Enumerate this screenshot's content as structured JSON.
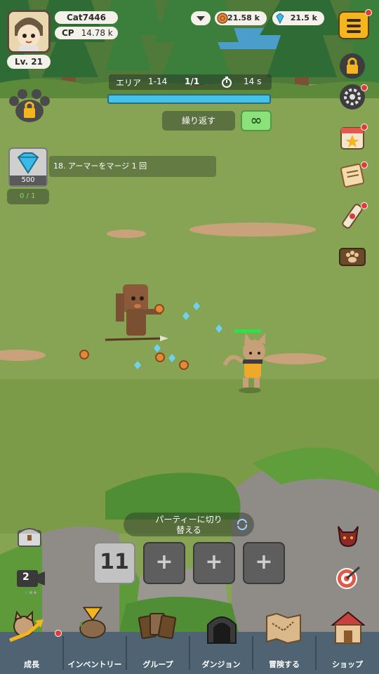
{
  "player": {
    "name": "Cat7446",
    "cp_label": "CP",
    "cp_value": "14.78 k",
    "level": "Lv. 21"
  },
  "resources": {
    "coins": "21.58 k",
    "gems": "21.5 k"
  },
  "stage": {
    "area_label": "エリア",
    "area_value": "1-14",
    "wave": "1/1",
    "timer": "14 s",
    "progress": 1.0,
    "repeat_label": "繰り返す",
    "infinite_symbol": "∞"
  },
  "quest": {
    "reward_count": "500",
    "text": "18. アーマーをマージ 1 回",
    "progress": "0 / 1"
  },
  "party": {
    "switch_label_line1": "パーティーに切り",
    "switch_label_line2": "替える",
    "slots": [
      {
        "label": "11"
      },
      {
        "label": "+"
      },
      {
        "label": "+"
      },
      {
        "label": "+"
      }
    ]
  },
  "left_tools": {
    "replay_count": "2"
  },
  "nav": {
    "items": [
      {
        "label": "成長"
      },
      {
        "label": "インベントリー"
      },
      {
        "label": "グループ"
      },
      {
        "label": "ダンジョン"
      },
      {
        "label": "冒険する"
      },
      {
        "label": "ショップ"
      }
    ]
  },
  "colors": {
    "accent": "#f5b51f",
    "progress": "#45c2e8",
    "nav_bg": "#4f6372",
    "infinite_btn": "#8ce27a"
  }
}
